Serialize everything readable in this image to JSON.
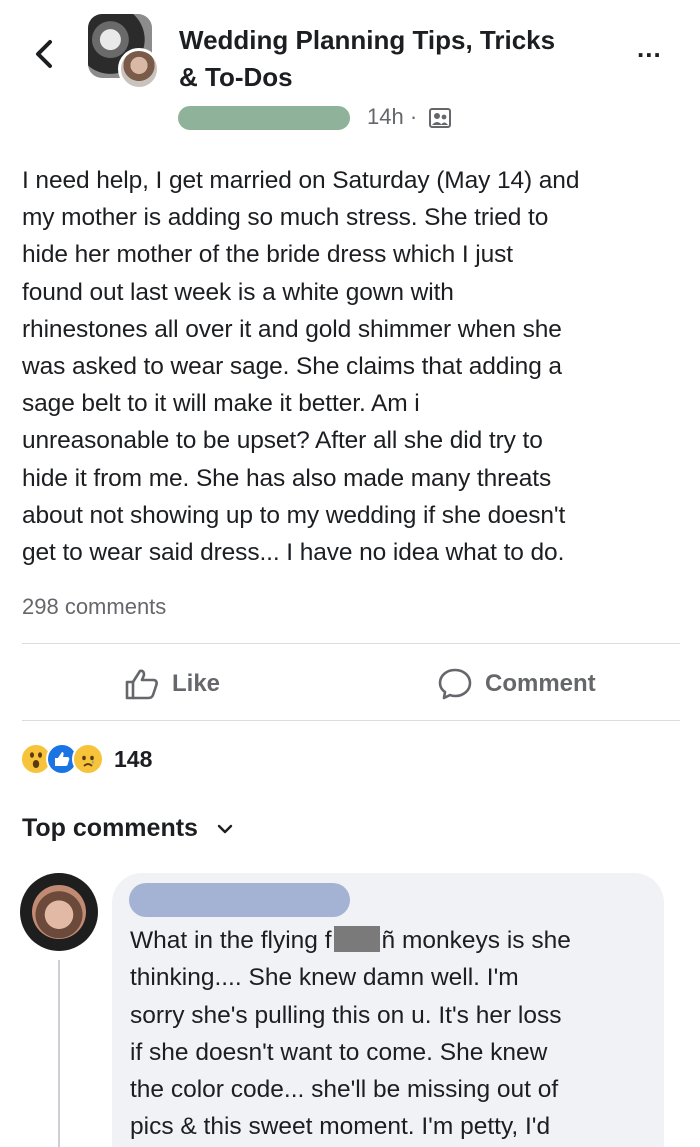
{
  "header": {
    "group_name_line1": "Wedding Planning Tips, Tricks",
    "group_name_line2": "& To-Dos",
    "time": "14h ·",
    "more_label": "..."
  },
  "post": {
    "lines": [
      "I need help, I get married on Saturday (May 14) and",
      "my mother is adding so much stress. She tried to",
      "hide her mother of the bride dress which I just",
      "found out last week is a white gown with",
      "rhinestones all over it and gold shimmer when she",
      "was asked to wear sage. She claims that adding a",
      "sage belt to it will make it better. Am i",
      "unreasonable to be upset? After all she did try to",
      "hide it from me. She has also made many threats",
      "about not showing up to my wedding if she doesn't",
      "get to wear said dress... I have no idea what to do."
    ],
    "comment_count": "298 comments"
  },
  "actions": {
    "like_label": "Like",
    "comment_label": "Comment"
  },
  "reactions": {
    "types": [
      "wow",
      "like",
      "sad"
    ],
    "count": "148"
  },
  "top_comments": {
    "label": "Top comments",
    "comment": {
      "line1_before": "What in the flying f",
      "line1_after": "ñ monkeys is she",
      "lines": [
        "thinking.... She knew damn well. I'm",
        "sorry she's pulling this on u. It's her loss",
        "if she doesn't want to come. She knew",
        "the color code... she'll be missing out of",
        "pics & this sweet moment. I'm petty, I'd"
      ]
    }
  },
  "colors": {
    "text": "#1c1e21",
    "secondary": "#65676b",
    "divider": "#dadde1",
    "like_blue": "#1b74e4",
    "bubble": "#f0f2f5"
  },
  "icons": [
    "back-arrow-icon",
    "more-dots-icon",
    "group-privacy-icon",
    "thumbs-up-icon",
    "comment-bubble-icon",
    "wow-reaction-icon",
    "like-reaction-icon",
    "sad-reaction-icon",
    "chevron-down-icon"
  ]
}
